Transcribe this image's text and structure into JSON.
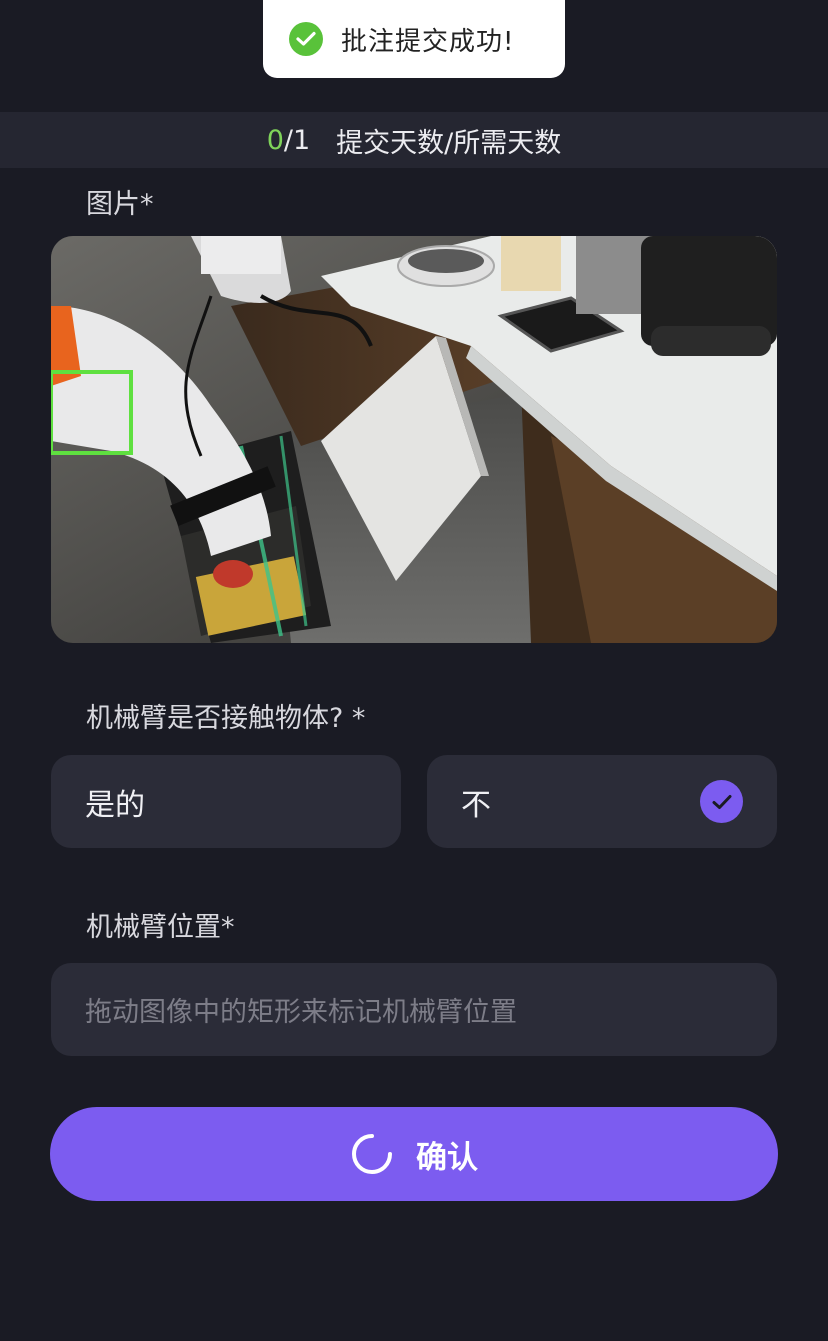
{
  "toast": {
    "icon": "check-circle-icon",
    "message": "批注提交成功!"
  },
  "progress": {
    "done": "0",
    "total": "/1",
    "label": "提交天数/所需天数"
  },
  "image_section": {
    "label": "图片*"
  },
  "question": {
    "label": "机械臂是否接触物体? *",
    "options": [
      {
        "label": "是的",
        "selected": false
      },
      {
        "label": "不",
        "selected": true
      }
    ]
  },
  "position_section": {
    "label": "机械臂位置*",
    "placeholder": "拖动图像中的矩形来标记机械臂位置"
  },
  "confirm_button": {
    "label": "确认",
    "icon": "loading-spinner-icon"
  },
  "colors": {
    "background": "#1a1b24",
    "accent": "#7c5cf0",
    "success": "#59c23a",
    "progress_done": "#7fd35a",
    "annotation_box": "#5fe040"
  }
}
